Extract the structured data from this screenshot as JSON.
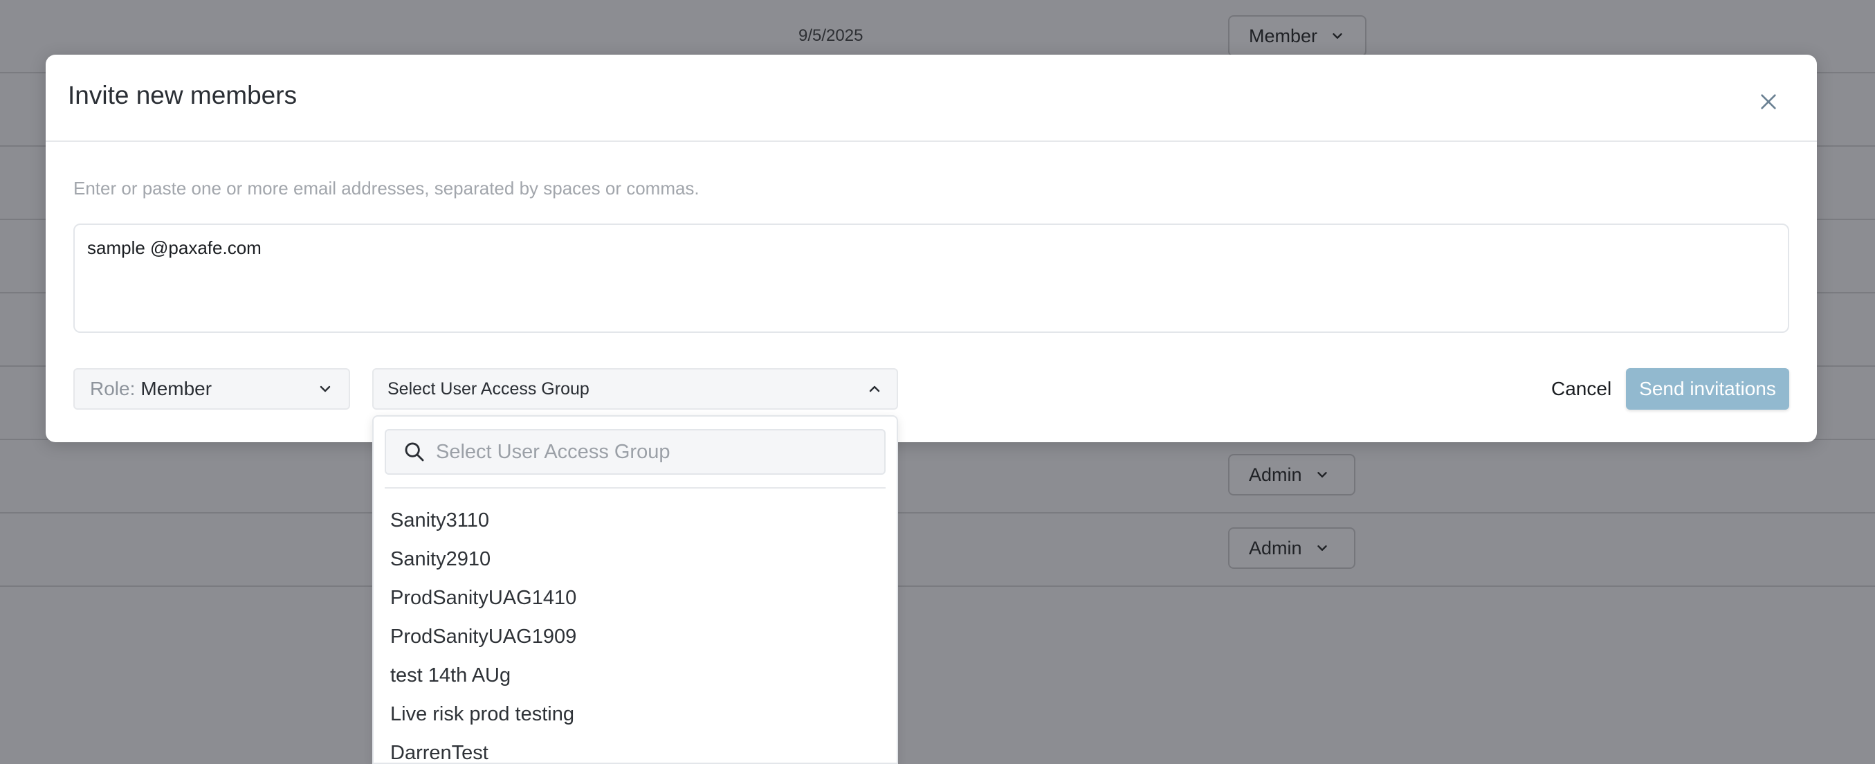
{
  "background_table": {
    "rows": [
      {
        "date": "9/5/2025",
        "role": "Member"
      },
      {
        "date": "",
        "role": ""
      },
      {
        "date": "",
        "role": ""
      },
      {
        "date": "",
        "role": ""
      },
      {
        "date": "",
        "role": ""
      },
      {
        "date": "",
        "role": ""
      },
      {
        "date": "",
        "role": "Admin"
      },
      {
        "date": "",
        "role": "Admin"
      }
    ]
  },
  "modal": {
    "title": "Invite new members",
    "hint": "Enter or paste one or more email addresses, separated by spaces or commas.",
    "email_value": "sample @paxafe.com",
    "role": {
      "label": "Role:",
      "value": "Member"
    },
    "uag_select": {
      "label": "Select User Access Group",
      "open": true
    },
    "cancel_label": "Cancel",
    "send_label": "Send invitations",
    "send_color": "#92b9cf"
  },
  "dropdown": {
    "search_placeholder": "Select User Access Group",
    "items": [
      "Sanity3110",
      "Sanity2910",
      "ProdSanityUAG1410",
      "ProdSanityUAG1909",
      "test 14th AUg",
      "Live risk prod testing",
      "DarrenTest"
    ]
  },
  "icons": {
    "close": "close-icon",
    "chevron_down": "chevron-down-icon",
    "chevron_up": "chevron-up-icon",
    "search": "search-icon"
  }
}
